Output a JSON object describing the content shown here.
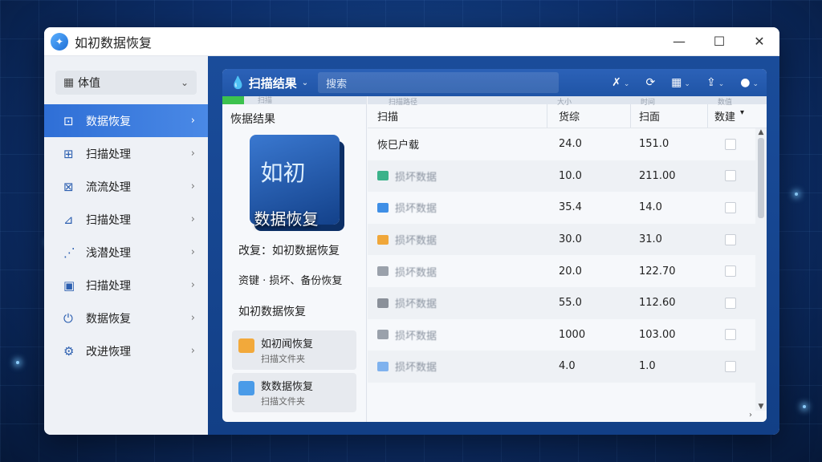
{
  "app": {
    "title": "如初数据恢复",
    "logo_glyph": "✦"
  },
  "window_controls": {
    "minimize": "—",
    "maximize": "☐",
    "close": "✕"
  },
  "sidebar": {
    "select": {
      "icon": "grid-icon",
      "glyph": "▦",
      "label": "体值",
      "chevron": "⌄"
    },
    "items": [
      {
        "icon": "data-recovery-icon",
        "glyph": "⊡",
        "label": "数据恢复",
        "active": true
      },
      {
        "icon": "scan-icon",
        "glyph": "⊞",
        "label": "扫描处理"
      },
      {
        "icon": "flow-icon",
        "glyph": "⊠",
        "label": "流流处理"
      },
      {
        "icon": "chart-icon",
        "glyph": "⊿",
        "label": "扫描处理"
      },
      {
        "icon": "network-icon",
        "glyph": "⋰",
        "label": "浅潜处理"
      },
      {
        "icon": "document-icon",
        "glyph": "▣",
        "label": "扫描处理"
      },
      {
        "icon": "power-icon",
        "glyph": "⏻",
        "label": "数据恢复"
      },
      {
        "icon": "settings-icon",
        "glyph": "⚙",
        "label": "改进恢理"
      }
    ],
    "chevron": "›"
  },
  "toolbar": {
    "title": "扫描结果",
    "search_placeholder": "搜索",
    "icons": [
      {
        "name": "tools-icon",
        "glyph": "✗"
      },
      {
        "name": "refresh-icon",
        "glyph": "⟳"
      },
      {
        "name": "grid-view-icon",
        "glyph": "▦"
      },
      {
        "name": "share-icon",
        "glyph": "⇪"
      },
      {
        "name": "user-icon",
        "glyph": "●"
      }
    ],
    "caret": "⌄"
  },
  "left_panel": {
    "progress_label": "扫描",
    "progress_fraction": 0.15,
    "title": "恢据结果",
    "cube_text_top": "如初",
    "cube_text_bottom": "数据恢复",
    "line1": "改复：如初数据恢复",
    "line2": "资键 · 损坏、备份恢复",
    "line3": "如初数据恢复",
    "cards": [
      {
        "title": "如初闻恢复",
        "sub": "扫描文件夹",
        "color": "#f2a93b"
      },
      {
        "title": "数数据恢复",
        "sub": "扫描文件夹",
        "color": "#4a9be8"
      }
    ]
  },
  "table": {
    "ghost_headers": [
      "扫描路径",
      "大小",
      "时间",
      "数值"
    ],
    "headers": [
      "扫描",
      "货综",
      "扫面",
      "数建"
    ],
    "rows": [
      {
        "name": "恢巳户载",
        "size": "24.0",
        "time": "151.0",
        "icon_color": "",
        "blur": false
      },
      {
        "name": "损坏数据",
        "size": "10.0",
        "time": "211.00",
        "icon_color": "#3bb28a",
        "blur": true
      },
      {
        "name": "损坏数据",
        "size": "35.4",
        "time": "14.0",
        "icon_color": "#3f8fe6",
        "blur": true
      },
      {
        "name": "损坏数据",
        "size": "30.0",
        "time": "31.0",
        "icon_color": "#f0a73a",
        "blur": true
      },
      {
        "name": "损坏数据",
        "size": "20.0",
        "time": "122.70",
        "icon_color": "#9aa1ab",
        "blur": true
      },
      {
        "name": "损坏数据",
        "size": "55.0",
        "time": "112.60",
        "icon_color": "#8a9099",
        "blur": true
      },
      {
        "name": "损坏数据",
        "size": "1000",
        "time": "103.00",
        "icon_color": "#9aa1ab",
        "blur": true
      },
      {
        "name": "损坏数据",
        "size": "4.0",
        "time": "1.0",
        "icon_color": "#7fb2ee",
        "blur": true
      }
    ],
    "scroll_up": "▲",
    "scroll_down": "▼",
    "scroll_right": "›",
    "header_caret": "▾"
  }
}
